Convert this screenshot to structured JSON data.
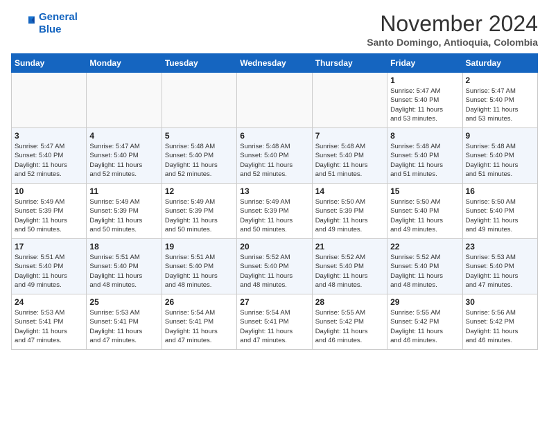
{
  "header": {
    "logo_line1": "General",
    "logo_line2": "Blue",
    "month": "November 2024",
    "location": "Santo Domingo, Antioquia, Colombia"
  },
  "weekdays": [
    "Sunday",
    "Monday",
    "Tuesday",
    "Wednesday",
    "Thursday",
    "Friday",
    "Saturday"
  ],
  "weeks": [
    [
      {
        "day": "",
        "info": ""
      },
      {
        "day": "",
        "info": ""
      },
      {
        "day": "",
        "info": ""
      },
      {
        "day": "",
        "info": ""
      },
      {
        "day": "",
        "info": ""
      },
      {
        "day": "1",
        "info": "Sunrise: 5:47 AM\nSunset: 5:40 PM\nDaylight: 11 hours\nand 53 minutes."
      },
      {
        "day": "2",
        "info": "Sunrise: 5:47 AM\nSunset: 5:40 PM\nDaylight: 11 hours\nand 53 minutes."
      }
    ],
    [
      {
        "day": "3",
        "info": "Sunrise: 5:47 AM\nSunset: 5:40 PM\nDaylight: 11 hours\nand 52 minutes."
      },
      {
        "day": "4",
        "info": "Sunrise: 5:47 AM\nSunset: 5:40 PM\nDaylight: 11 hours\nand 52 minutes."
      },
      {
        "day": "5",
        "info": "Sunrise: 5:48 AM\nSunset: 5:40 PM\nDaylight: 11 hours\nand 52 minutes."
      },
      {
        "day": "6",
        "info": "Sunrise: 5:48 AM\nSunset: 5:40 PM\nDaylight: 11 hours\nand 52 minutes."
      },
      {
        "day": "7",
        "info": "Sunrise: 5:48 AM\nSunset: 5:40 PM\nDaylight: 11 hours\nand 51 minutes."
      },
      {
        "day": "8",
        "info": "Sunrise: 5:48 AM\nSunset: 5:40 PM\nDaylight: 11 hours\nand 51 minutes."
      },
      {
        "day": "9",
        "info": "Sunrise: 5:48 AM\nSunset: 5:40 PM\nDaylight: 11 hours\nand 51 minutes."
      }
    ],
    [
      {
        "day": "10",
        "info": "Sunrise: 5:49 AM\nSunset: 5:39 PM\nDaylight: 11 hours\nand 50 minutes."
      },
      {
        "day": "11",
        "info": "Sunrise: 5:49 AM\nSunset: 5:39 PM\nDaylight: 11 hours\nand 50 minutes."
      },
      {
        "day": "12",
        "info": "Sunrise: 5:49 AM\nSunset: 5:39 PM\nDaylight: 11 hours\nand 50 minutes."
      },
      {
        "day": "13",
        "info": "Sunrise: 5:49 AM\nSunset: 5:39 PM\nDaylight: 11 hours\nand 50 minutes."
      },
      {
        "day": "14",
        "info": "Sunrise: 5:50 AM\nSunset: 5:39 PM\nDaylight: 11 hours\nand 49 minutes."
      },
      {
        "day": "15",
        "info": "Sunrise: 5:50 AM\nSunset: 5:40 PM\nDaylight: 11 hours\nand 49 minutes."
      },
      {
        "day": "16",
        "info": "Sunrise: 5:50 AM\nSunset: 5:40 PM\nDaylight: 11 hours\nand 49 minutes."
      }
    ],
    [
      {
        "day": "17",
        "info": "Sunrise: 5:51 AM\nSunset: 5:40 PM\nDaylight: 11 hours\nand 49 minutes."
      },
      {
        "day": "18",
        "info": "Sunrise: 5:51 AM\nSunset: 5:40 PM\nDaylight: 11 hours\nand 48 minutes."
      },
      {
        "day": "19",
        "info": "Sunrise: 5:51 AM\nSunset: 5:40 PM\nDaylight: 11 hours\nand 48 minutes."
      },
      {
        "day": "20",
        "info": "Sunrise: 5:52 AM\nSunset: 5:40 PM\nDaylight: 11 hours\nand 48 minutes."
      },
      {
        "day": "21",
        "info": "Sunrise: 5:52 AM\nSunset: 5:40 PM\nDaylight: 11 hours\nand 48 minutes."
      },
      {
        "day": "22",
        "info": "Sunrise: 5:52 AM\nSunset: 5:40 PM\nDaylight: 11 hours\nand 48 minutes."
      },
      {
        "day": "23",
        "info": "Sunrise: 5:53 AM\nSunset: 5:40 PM\nDaylight: 11 hours\nand 47 minutes."
      }
    ],
    [
      {
        "day": "24",
        "info": "Sunrise: 5:53 AM\nSunset: 5:41 PM\nDaylight: 11 hours\nand 47 minutes."
      },
      {
        "day": "25",
        "info": "Sunrise: 5:53 AM\nSunset: 5:41 PM\nDaylight: 11 hours\nand 47 minutes."
      },
      {
        "day": "26",
        "info": "Sunrise: 5:54 AM\nSunset: 5:41 PM\nDaylight: 11 hours\nand 47 minutes."
      },
      {
        "day": "27",
        "info": "Sunrise: 5:54 AM\nSunset: 5:41 PM\nDaylight: 11 hours\nand 47 minutes."
      },
      {
        "day": "28",
        "info": "Sunrise: 5:55 AM\nSunset: 5:42 PM\nDaylight: 11 hours\nand 46 minutes."
      },
      {
        "day": "29",
        "info": "Sunrise: 5:55 AM\nSunset: 5:42 PM\nDaylight: 11 hours\nand 46 minutes."
      },
      {
        "day": "30",
        "info": "Sunrise: 5:56 AM\nSunset: 5:42 PM\nDaylight: 11 hours\nand 46 minutes."
      }
    ]
  ]
}
